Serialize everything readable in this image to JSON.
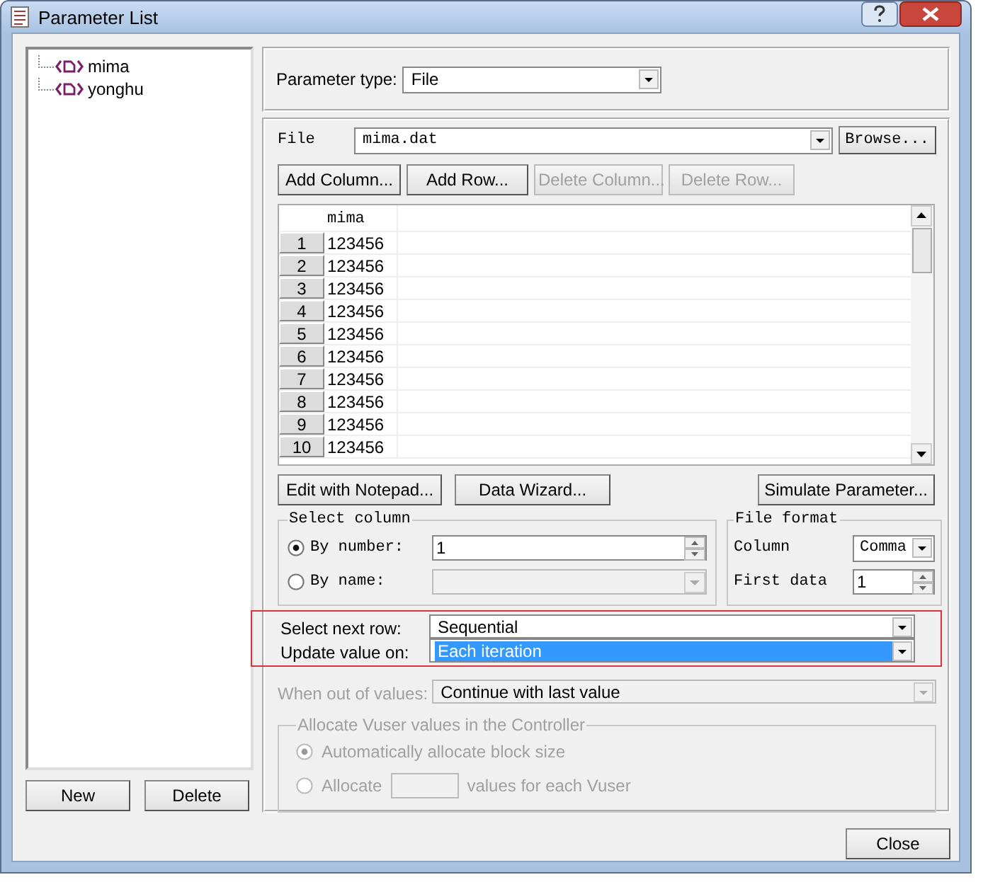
{
  "window": {
    "title": "Parameter List"
  },
  "tree": [
    {
      "label": "mima",
      "selected": false
    },
    {
      "label": "yonghu",
      "selected": false
    }
  ],
  "left_buttons": [
    {
      "label": "New",
      "disabled": false
    },
    {
      "label": "Delete",
      "disabled": false
    }
  ],
  "parameter_type": {
    "label": "Parameter type:",
    "value": "File"
  },
  "file": {
    "label": "File",
    "value": "mima.dat",
    "browse": "Browse..."
  },
  "table_buttons": [
    {
      "label": "Add Column...",
      "disabled": false
    },
    {
      "label": "Add Row...",
      "disabled": false
    },
    {
      "label": "Delete Column...",
      "disabled": true
    },
    {
      "label": "Delete Row...",
      "disabled": true
    }
  ],
  "table": {
    "columns": [
      "mima"
    ],
    "rows": [
      {
        "number": "1",
        "cells": [
          "123456"
        ]
      },
      {
        "number": "2",
        "cells": [
          "123456"
        ]
      },
      {
        "number": "3",
        "cells": [
          "123456"
        ]
      },
      {
        "number": "4",
        "cells": [
          "123456"
        ]
      },
      {
        "number": "5",
        "cells": [
          "123456"
        ]
      },
      {
        "number": "6",
        "cells": [
          "123456"
        ]
      },
      {
        "number": "7",
        "cells": [
          "123456"
        ]
      },
      {
        "number": "8",
        "cells": [
          "123456"
        ]
      },
      {
        "number": "9",
        "cells": [
          "123456"
        ]
      },
      {
        "number": "10",
        "cells": [
          "123456"
        ]
      }
    ]
  },
  "data_buttons": [
    {
      "label": "Edit with Notepad...",
      "disabled": false
    },
    {
      "label": "Data Wizard...",
      "disabled": false
    }
  ],
  "simulate_button": "Simulate Parameter...",
  "select_column": {
    "title": "Select column",
    "options": [
      {
        "kind": "spin",
        "label": "By number:",
        "value": "1",
        "selected": true,
        "disabled": false
      },
      {
        "kind": "combo",
        "label": "By name:",
        "selected": false,
        "disabled": true
      }
    ]
  },
  "file_format": {
    "title": "File format",
    "column_label": "Column",
    "column_value": "Comma",
    "first_data_label": "First data",
    "first_data_value": "1"
  },
  "select_next_row": {
    "label": "Select next row:",
    "value": "Sequential",
    "focused": false
  },
  "update_value_on": {
    "label": "Update value on:",
    "value": "Each iteration",
    "focused": true
  },
  "when_out_of_values": {
    "label": "When out of values:",
    "value": "Continue with last value",
    "disabled": true
  },
  "allocate": {
    "title": "Allocate Vuser values in the Controller",
    "disabled": true,
    "options": [
      {
        "kind": "auto",
        "label": "Automatically allocate block size",
        "selected": true
      },
      {
        "kind": "count",
        "label": "Allocate",
        "suffix": "values for each Vuser",
        "selected": false
      }
    ]
  },
  "close_button": "Close"
}
